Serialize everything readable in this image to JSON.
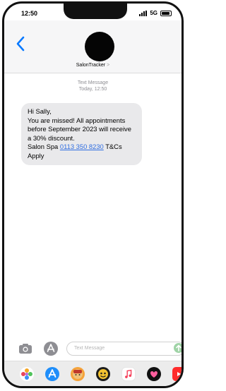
{
  "status_bar": {
    "time": "12:50",
    "network": "5G"
  },
  "header": {
    "contact_name": "SalonTracker",
    "contact_chevron": ">"
  },
  "thread": {
    "label": "Text Message",
    "timestamp": "Today, 12:50"
  },
  "message": {
    "greeting": "Hi Sally,",
    "body": "You are missed! All appointments before September 2023 will receive a 30% discount.",
    "sender": "Salon Spa",
    "phone": "0113 350 8230",
    "suffix": "T&Cs Apply"
  },
  "composer": {
    "placeholder": "Text Message"
  },
  "dock": {
    "apps": [
      {
        "icon": "photos-icon",
        "color": "#ffffff"
      },
      {
        "icon": "app-store-icon",
        "color": "#1f8efa"
      },
      {
        "icon": "memoji-icon",
        "color": "#f5a33a"
      },
      {
        "icon": "animoji-icon",
        "color": "#1c1c1c"
      },
      {
        "icon": "music-icon",
        "color": "#ffffff"
      },
      {
        "icon": "heart-sticker-icon",
        "color": "#111111"
      },
      {
        "icon": "youtube-icon",
        "color": "#ff2b2b"
      }
    ]
  },
  "colors": {
    "accent": "#0a7aff",
    "bubble": "#e9e9eb",
    "link": "#2f6de1"
  }
}
